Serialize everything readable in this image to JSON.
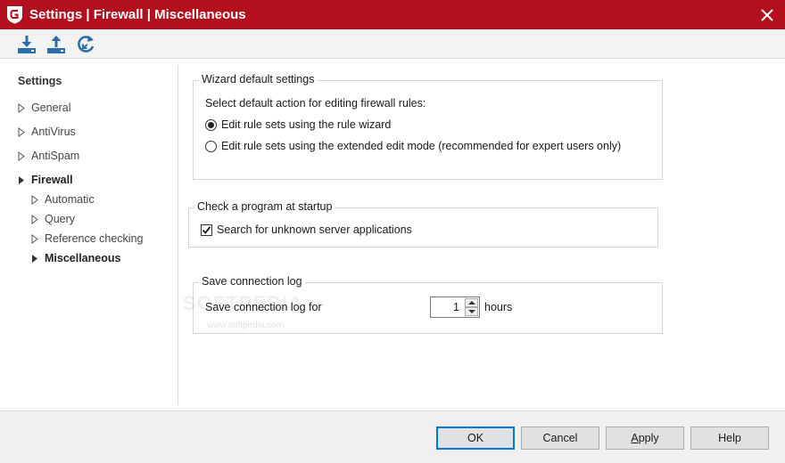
{
  "window": {
    "title": "Settings | Firewall | Miscellaneous",
    "accent_color": "#b30f1f",
    "logo_icon": "g-data-shield-logo",
    "close_icon": "close-icon"
  },
  "toolbar": {
    "buttons": [
      {
        "icon": "import-icon"
      },
      {
        "icon": "export-icon"
      },
      {
        "icon": "restore-defaults-icon"
      }
    ]
  },
  "sidebar": {
    "title": "Settings",
    "items": [
      {
        "label": "General",
        "level": 0,
        "expanded": false
      },
      {
        "label": "AntiVirus",
        "level": 0,
        "expanded": false
      },
      {
        "label": "AntiSpam",
        "level": 0,
        "expanded": false
      },
      {
        "label": "Firewall",
        "level": 0,
        "expanded": true
      },
      {
        "label": "Automatic",
        "level": 1
      },
      {
        "label": "Query",
        "level": 1
      },
      {
        "label": "Reference checking",
        "level": 1
      },
      {
        "label": "Miscellaneous",
        "level": 1,
        "selected": true
      }
    ]
  },
  "wizard_group": {
    "title": "Wizard default settings",
    "prompt": "Select default action for editing firewall rules:",
    "options": [
      {
        "label": "Edit rule sets using the rule wizard",
        "checked": true
      },
      {
        "label": "Edit rule sets using the extended edit mode (recommended for expert users only)",
        "checked": false
      }
    ]
  },
  "startup_group": {
    "title": "Check a program at startup",
    "checkbox_label": "Search for unknown server applications",
    "checked": true
  },
  "log_group": {
    "title": "Save connection log",
    "label": "Save connection log for",
    "value": "1",
    "unit": "hours"
  },
  "watermark": {
    "main": "SOFTPEDIA",
    "sub": "www.softpedia.com"
  },
  "footer": {
    "ok_label": "OK",
    "cancel_label": "Cancel",
    "apply_label_mnemonic": "A",
    "apply_label_rest": "pply",
    "help_label": "Help"
  }
}
